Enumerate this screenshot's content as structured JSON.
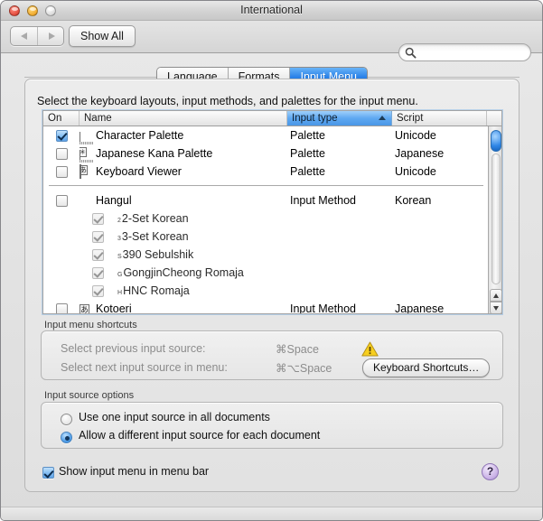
{
  "window": {
    "title": "International",
    "traffic_lights": [
      "close",
      "minimize",
      "zoom"
    ]
  },
  "toolbar": {
    "back_icon": "left-arrow-icon",
    "forward_icon": "right-arrow-icon",
    "show_all_label": "Show All",
    "search": {
      "value": "",
      "placeholder": "",
      "icon": "search-icon"
    }
  },
  "tabs": [
    {
      "label": "Language",
      "active": false
    },
    {
      "label": "Formats",
      "active": false
    },
    {
      "label": "Input Menu",
      "active": true
    }
  ],
  "instruction": "Select the keyboard layouts, input methods, and palettes for the input menu.",
  "table": {
    "columns": [
      {
        "key": "on",
        "label": "On",
        "sorted": false
      },
      {
        "key": "name",
        "label": "Name",
        "sorted": false
      },
      {
        "key": "type",
        "label": "Input type",
        "sorted": true,
        "sort_direction": "ascending"
      },
      {
        "key": "script",
        "label": "Script",
        "sorted": false
      }
    ],
    "rows": [
      {
        "on": true,
        "name": "Character Palette",
        "type": "Palette",
        "script": "Unicode",
        "icon": "character-palette-icon",
        "level": 0
      },
      {
        "on": false,
        "name": "Japanese Kana Palette",
        "type": "Palette",
        "script": "Japanese",
        "icon": "kana-palette-icon",
        "level": 0
      },
      {
        "on": false,
        "name": "Keyboard Viewer",
        "type": "Palette",
        "script": "Unicode",
        "icon": "keyboard-viewer-icon",
        "level": 0
      },
      {
        "separator": true
      },
      {
        "on": false,
        "name": "Hangul",
        "type": "Input Method",
        "script": "Korean",
        "icon": "taegeuk-icon",
        "level": 0
      },
      {
        "on": true,
        "name": "2-Set Korean",
        "type": "",
        "script": "",
        "icon": "taegeuk-sub-icon",
        "sub_letter": "2",
        "level": 1,
        "dimmed": true
      },
      {
        "on": true,
        "name": "3-Set Korean",
        "type": "",
        "script": "",
        "icon": "taegeuk-sub-icon",
        "sub_letter": "3",
        "level": 1,
        "dimmed": true
      },
      {
        "on": true,
        "name": "390 Sebulshik",
        "type": "",
        "script": "",
        "icon": "taegeuk-sub-icon",
        "sub_letter": "S",
        "level": 1,
        "dimmed": true
      },
      {
        "on": true,
        "name": "GongjinCheong Romaja",
        "type": "",
        "script": "",
        "icon": "taegeuk-sub-icon",
        "sub_letter": "G",
        "level": 1,
        "dimmed": true
      },
      {
        "on": true,
        "name": "HNC Romaja",
        "type": "",
        "script": "",
        "icon": "taegeuk-sub-icon",
        "sub_letter": "H",
        "level": 1,
        "dimmed": true
      },
      {
        "on": false,
        "name": "Kotoeri",
        "type": "Input Method",
        "script": "Japanese",
        "icon": "kotoeri-icon",
        "level": 0
      }
    ],
    "scrollbar": {
      "orientation": "vertical",
      "thumb_position": "top"
    }
  },
  "shortcuts": {
    "group_label": "Input menu shortcuts",
    "previous_label": "Select previous input source:",
    "previous_key": "⌘Space",
    "next_label": "Select next input source in menu:",
    "next_key": "⌘⌥Space",
    "warning_icon": "warning-triangle-icon",
    "button_label": "Keyboard Shortcuts…"
  },
  "input_source_options": {
    "group_label": "Input source options",
    "options": [
      {
        "label": "Use one input source in all documents",
        "selected": false
      },
      {
        "label": "Allow a different input source for each document",
        "selected": true
      }
    ]
  },
  "show_menu": {
    "label": "Show input menu in menu bar",
    "checked": true
  },
  "help": {
    "label": "?",
    "icon": "help-icon"
  },
  "colors": {
    "accent_blue": "#2a82e8",
    "selected_header": "#5ea8f1",
    "warning_yellow": "#f5c518",
    "help_purple": "#cdb6e8"
  }
}
